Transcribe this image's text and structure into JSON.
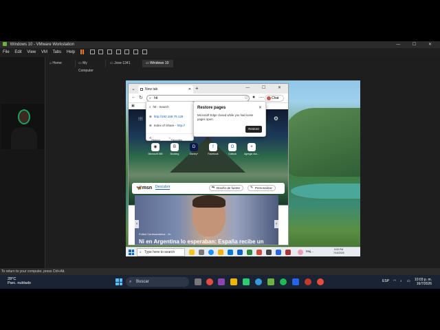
{
  "vmware": {
    "title": "Windows 10 - VMware Workstation",
    "menu": [
      "File",
      "Edit",
      "View",
      "VM",
      "Tabs",
      "Help"
    ],
    "tabs": [
      "Home",
      "My Computer",
      "Jose-1341",
      "Windows 10"
    ],
    "status": "To return to your computer, press Ctrl+Alt."
  },
  "edge": {
    "tab_title": "New tab",
    "address_text": "htt",
    "profile": "Chat",
    "quicklinks": [
      "Microsoft 365",
      "Booking",
      "Disney+",
      "Facebook",
      "Outlook",
      "Agregar acc..."
    ],
    "omnibox": {
      "suggest_search": "htt - Search",
      "suggest_url": "http://192.168.79.128",
      "suggest_index_prefix": "Index of /share - ",
      "suggest_index_link": "http://",
      "history": "History",
      "favorites": "Favorites"
    },
    "restore": {
      "title": "Restore pages",
      "message": "Microsoft Edge closed while you had some pages open.",
      "button": "Restore"
    },
    "msn": {
      "logo": "msn",
      "discover": "Descubrir",
      "theme_btn": "Diseño de fuente",
      "personalize_btn": "Personalizar",
      "news_category": "Fútbol Centroamérica · 1h",
      "news_headline": "Ni en Argentina lo esperaban: España recibe un"
    }
  },
  "guest_taskbar": {
    "search_placeholder": "Type here to search",
    "tray_label": "Muj...",
    "time": "5:00 PM",
    "date": "7/16/2026"
  },
  "host_taskbar": {
    "temperature": "28°C",
    "weather": "Parc. nublado",
    "search_placeholder": "Buscar",
    "language": "ESP",
    "time": "10:03 p. m.",
    "date": "16/7/2026"
  }
}
